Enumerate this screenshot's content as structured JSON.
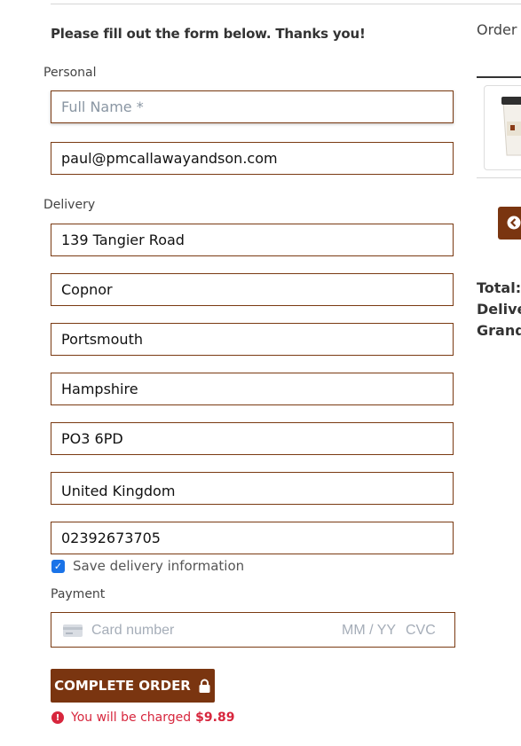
{
  "form": {
    "intro": "Please fill out the form below. Thanks you!",
    "personal_label": "Personal",
    "full_name_placeholder": "Full Name *",
    "email_value": "paul@pmcallawayandson.com",
    "delivery_label": "Delivery",
    "address1": "139 Tangier Road",
    "address2": "Copnor",
    "city": "Portsmouth",
    "county": "Hampshire",
    "postcode": "PO3 6PD",
    "country": "United Kingdom",
    "phone": "02392673705",
    "save_delivery_label": "Save delivery information",
    "save_delivery_checked": true,
    "payment_label": "Payment",
    "card_number_placeholder": "Card number",
    "card_expiry_placeholder": "MM / YY",
    "card_cvc_placeholder": "CVC",
    "complete_order_label": "COMPLETE ORDER",
    "charge_text": "You will be charged",
    "charge_amount": "$9.89"
  },
  "order_summary": {
    "title": "Order",
    "total_label": "Total:",
    "delivery_label": "Delive",
    "grand_total_label": "Grand"
  },
  "colors": {
    "brand_brown": "#7a3510",
    "field_border": "#7a3a12",
    "error_red": "#d7263d",
    "checkbox_blue": "#1a73e8"
  },
  "icons": {
    "lock": "lock-icon",
    "alert": "alert-circle-icon",
    "card": "credit-card-icon",
    "back": "chevron-left-circle-icon"
  }
}
